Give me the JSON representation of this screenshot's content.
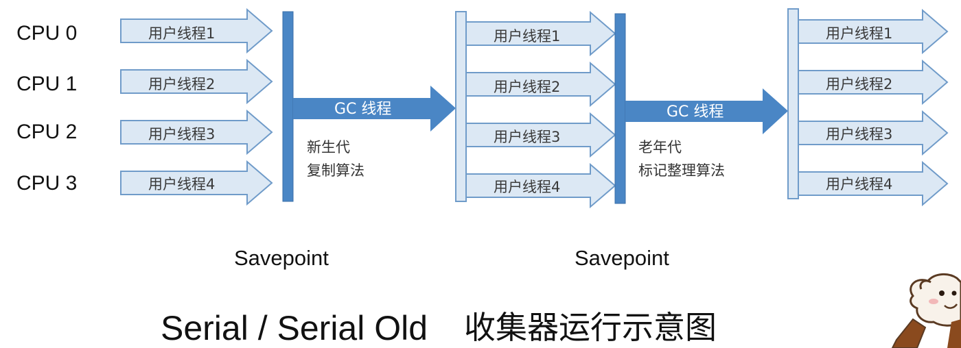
{
  "cpus": [
    "CPU 0",
    "CPU 1",
    "CPU 2",
    "CPU 3"
  ],
  "thread_labels": [
    "用户线程1",
    "用户线程2",
    "用户线程3",
    "用户线程4"
  ],
  "gc_threads": [
    {
      "label": "GC 线程",
      "note_lines": [
        "新生代",
        "复制算法"
      ]
    },
    {
      "label": "GC 线程",
      "note_lines": [
        "老年代",
        "标记整理算法"
      ]
    }
  ],
  "savepoints": [
    "Savepoint",
    "Savepoint"
  ],
  "caption": {
    "latin": "Serial / Serial Old",
    "cjk": "收集器运行示意图"
  },
  "colors": {
    "thread_fill": "#dce8f4",
    "thread_stroke": "#6f9bc9",
    "gc_fill": "#4a86c5",
    "barrier_dark": "#4a86c5",
    "barrier_light": "#dce8f4"
  },
  "mascot": "dog-mascot"
}
